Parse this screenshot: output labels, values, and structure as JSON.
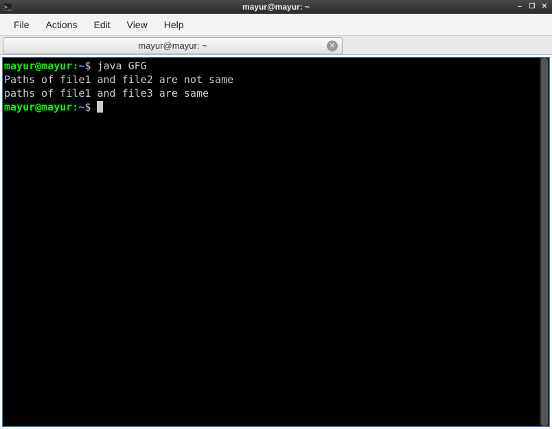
{
  "window": {
    "title": "mayur@mayur: ~"
  },
  "menubar": {
    "items": [
      "File",
      "Actions",
      "Edit",
      "View",
      "Help"
    ]
  },
  "tab": {
    "title": "mayur@mayur: ~"
  },
  "terminal": {
    "lines": [
      {
        "type": "prompt",
        "user": "mayur@mayur",
        "sep": ":",
        "path": "~",
        "dollar": "$",
        "command": "java GFG"
      },
      {
        "type": "output",
        "text": "Paths of file1 and file2 are not same"
      },
      {
        "type": "output",
        "text": "paths of file1 and file3 are same"
      },
      {
        "type": "prompt",
        "user": "mayur@mayur",
        "sep": ":",
        "path": "~",
        "dollar": "$",
        "command": "",
        "cursor": true
      }
    ]
  },
  "colors": {
    "prompt_user": "#00ff00",
    "prompt_path": "#5599ff",
    "terminal_bg": "#000000",
    "terminal_fg": "#cccccc"
  }
}
